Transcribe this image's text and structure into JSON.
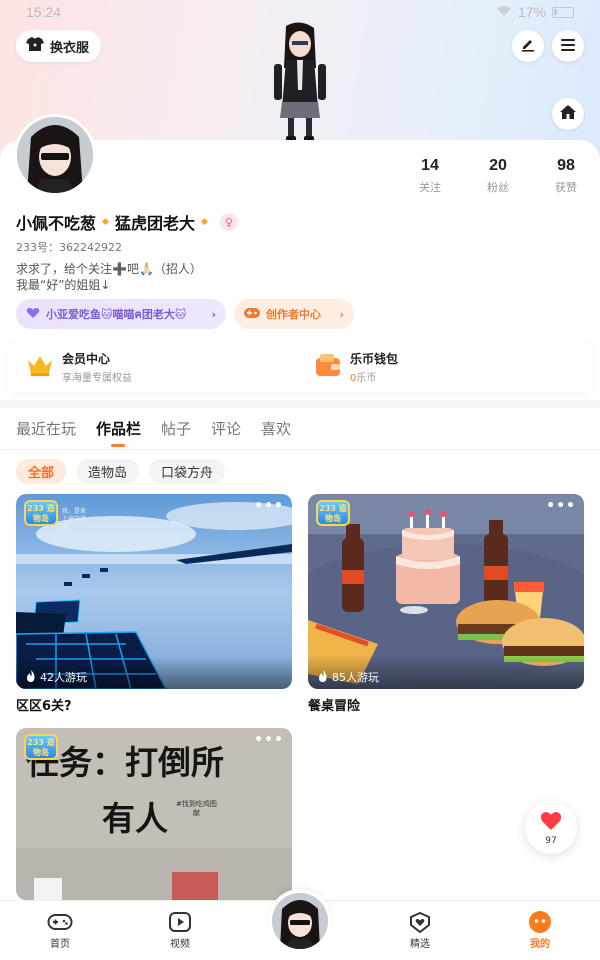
{
  "status_bar": {
    "time": "15:24",
    "battery": "17%"
  },
  "header": {
    "outfit_label": "换衣服"
  },
  "profile": {
    "stats": [
      {
        "value": "14",
        "label": "关注"
      },
      {
        "value": "20",
        "label": "粉丝"
      },
      {
        "value": "98",
        "label": "获赞"
      }
    ],
    "name_part1": "小佩不吃葱",
    "name_part2": "猛虎团老大",
    "uid": "233号：362242922",
    "bio_line1": "求求了，给个关注➕吧🙏🏻（招人）",
    "bio_line2": "我最“好”的姐姐↓",
    "guild_chip": "小亚爱吃鱼🐱喵喵ฅ团老大🐱",
    "creator_chip": "创作者中心"
  },
  "vip": {
    "member_title": "会员中心",
    "member_sub": "享海量专属权益",
    "wallet_title": "乐币钱包",
    "wallet_amount": "0",
    "wallet_unit": "乐币"
  },
  "tabs": [
    "最近在玩",
    "作品栏",
    "帖子",
    "评论",
    "喜欢"
  ],
  "active_tab": "作品栏",
  "filters": [
    "全部",
    "造物岛",
    "口袋方舟"
  ],
  "works": [
    {
      "title": "区区6关?",
      "plays": "42人游玩",
      "logo": "233 造物岛",
      "sign_text": "我，是来\n上来这里\n时"
    },
    {
      "title": "餐桌冒险",
      "plays": "85人游玩",
      "logo": "233 造物岛"
    },
    {
      "title": "",
      "plays": "",
      "logo": "233 造物岛",
      "cover_line1": "任务：打倒所",
      "cover_line2": "有人",
      "cover_small": "#找到吃鸡图\n献"
    }
  ],
  "like_fab": {
    "count": "97"
  },
  "bottom_nav": [
    {
      "label": "首页",
      "icon": "gamepad-icon"
    },
    {
      "label": "视频",
      "icon": "video-icon"
    },
    {
      "label": "精选",
      "icon": "heart-badge-icon"
    },
    {
      "label": "我的",
      "icon": "smile-face-icon"
    }
  ],
  "colors": {
    "accent": "#ff7a2e",
    "guild": "#7a5bd6",
    "creator": "#f07a2c"
  }
}
